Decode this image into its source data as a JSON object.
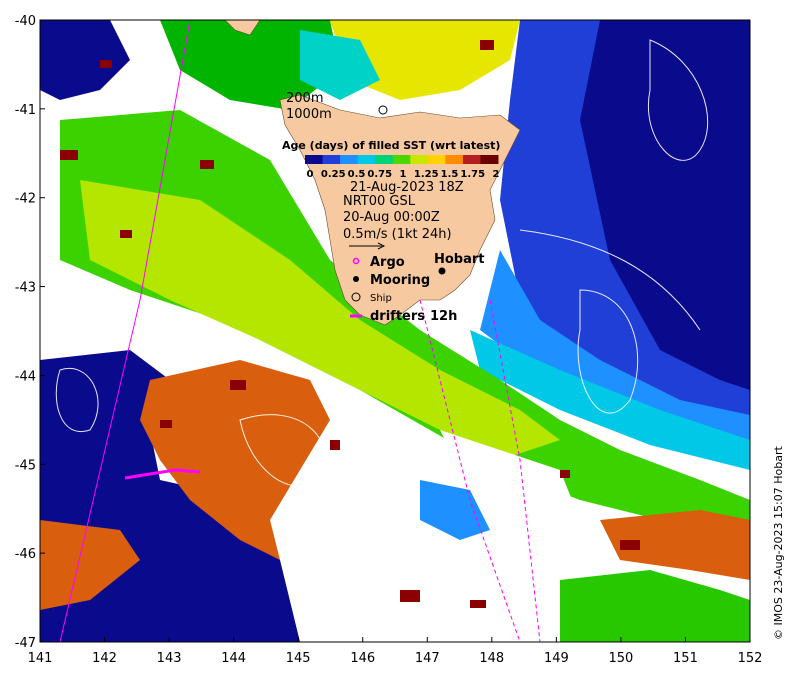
{
  "axes": {
    "x_ticks": [
      "141",
      "142",
      "143",
      "144",
      "145",
      "146",
      "147",
      "148",
      "149",
      "150",
      "151",
      "152"
    ],
    "y_ticks": [
      "-40",
      "-41",
      "-42",
      "-43",
      "-44",
      "-45",
      "-46",
      "-47"
    ]
  },
  "depth_labels": {
    "d200": "200m",
    "d1000": "1000m"
  },
  "legend": {
    "title": "Age (days) of filled SST (wrt latest)",
    "ticks": [
      "0",
      "0.25",
      "0.5",
      "0.75",
      "1",
      "1.25",
      "1.5",
      "1.75",
      "2"
    ],
    "colors": [
      "#0a0a8c",
      "#1f3fd6",
      "#1e90ff",
      "#00c8e6",
      "#00d27a",
      "#4cd600",
      "#c8e600",
      "#ffd200",
      "#ff8c00",
      "#b41e1e",
      "#6b0000"
    ]
  },
  "info": {
    "date": "21-Aug-2023 18Z",
    "product": "NRT00 GSL",
    "time": "20-Aug 00:00Z",
    "scale": "0.5m/s (1kt 24h)"
  },
  "symbols": {
    "argo": "Argo",
    "mooring": "Mooring",
    "ship": "Ship",
    "drifters": "drifters",
    "drifter_age": "12h"
  },
  "places": {
    "hobart": "Hobart"
  },
  "credit": "© IMOS 23-Aug-2023 15:07 Hobart",
  "colors": {
    "land": "#f7c9a0",
    "deep_blue": "#0a0a8c",
    "blue": "#1f3fd6",
    "light_blue": "#1e90ff",
    "green": "#00c800",
    "yellow_green": "#b4e600",
    "orange": "#d95f0e",
    "dark_red": "#8b0000",
    "magenta": "#ff00ff"
  }
}
